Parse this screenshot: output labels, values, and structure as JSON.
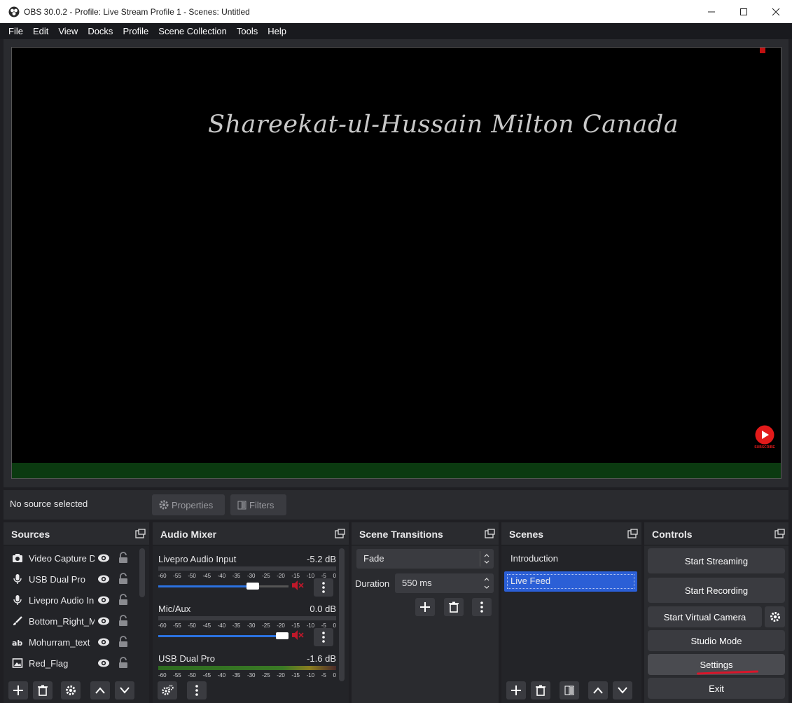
{
  "window": {
    "title": "OBS 30.0.2 - Profile: Live Stream Profile 1 - Scenes: Untitled"
  },
  "menu": [
    "File",
    "Edit",
    "View",
    "Docks",
    "Profile",
    "Scene Collection",
    "Tools",
    "Help"
  ],
  "preview": {
    "overlay_text": "Shareekat-ul-Hussain Milton Canada",
    "badge_text": "SUBSCRIBE"
  },
  "source_toolbar": {
    "status": "No source selected",
    "properties": "Properties",
    "filters": "Filters"
  },
  "sources": {
    "title": "Sources",
    "items": [
      {
        "name": "Video Capture Device",
        "icon": "camera-icon"
      },
      {
        "name": "USB Dual Pro",
        "icon": "mic-icon"
      },
      {
        "name": "Livepro Audio Input",
        "icon": "mic-icon"
      },
      {
        "name": "Bottom_Right_Mohurram",
        "icon": "brush-icon"
      },
      {
        "name": "Mohurram_text",
        "icon": "text-icon"
      },
      {
        "name": "Red_Flag",
        "icon": "image-icon"
      }
    ]
  },
  "mixer": {
    "title": "Audio Mixer",
    "scale": [
      "-60",
      "-55",
      "-50",
      "-45",
      "-40",
      "-35",
      "-30",
      "-25",
      "-20",
      "-15",
      "-10",
      "-5",
      "0"
    ],
    "channels": [
      {
        "name": "Livepro Audio Input",
        "db": "-5.2 dB",
        "level": 0.75,
        "muted": true
      },
      {
        "name": "Mic/Aux",
        "db": "0.0 dB",
        "level": 1.0,
        "muted": true
      },
      {
        "name": "USB Dual Pro",
        "db": "-1.6 dB",
        "level": 0.9,
        "muted": false
      }
    ]
  },
  "transitions": {
    "title": "Scene Transitions",
    "selected": "Fade",
    "duration_label": "Duration",
    "duration_value": "550 ms"
  },
  "scenes": {
    "title": "Scenes",
    "items": [
      "Introduction",
      "Live Feed"
    ],
    "selected": "Live Feed"
  },
  "controls": {
    "title": "Controls",
    "start_streaming": "Start Streaming",
    "start_recording": "Start Recording",
    "start_virtual_camera": "Start Virtual Camera",
    "studio_mode": "Studio Mode",
    "settings": "Settings",
    "exit": "Exit"
  },
  "colors": {
    "accent": "#2b72e0",
    "selection": "#2b5fd6",
    "annotation": "#d9152a",
    "youtube": "#e21a1a"
  }
}
